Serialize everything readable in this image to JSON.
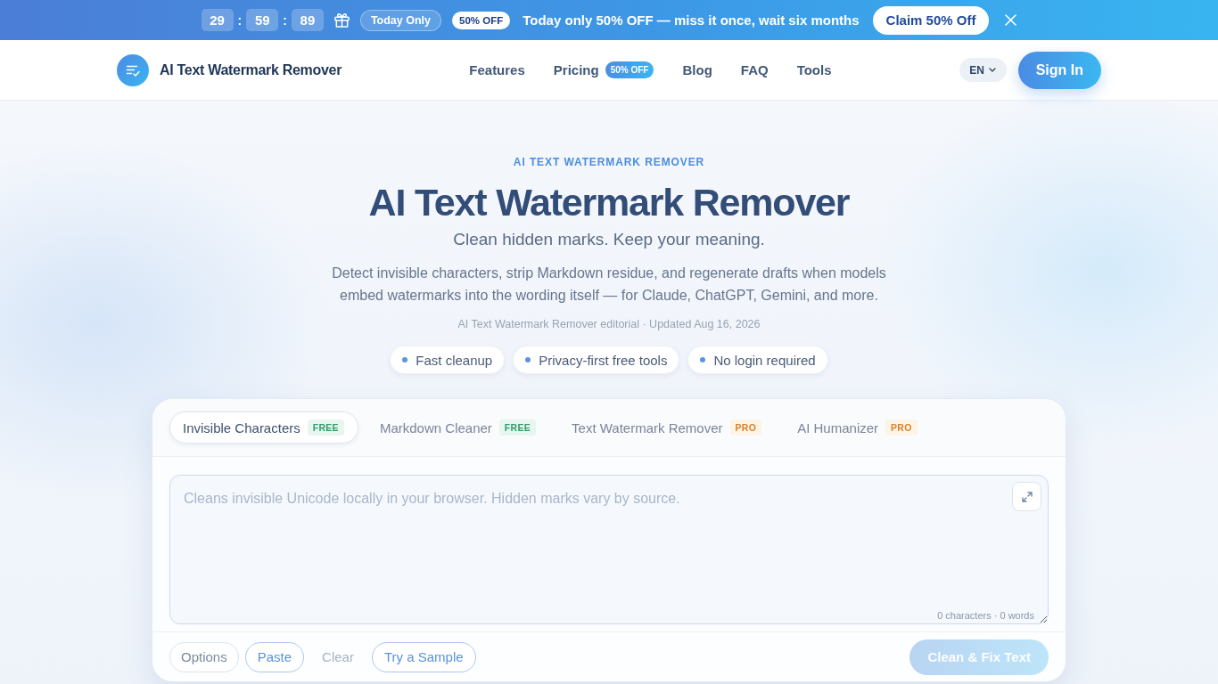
{
  "promo_bar": {
    "countdown": [
      "29",
      "59",
      "89"
    ],
    "separators": [
      ":",
      ":"
    ],
    "tag": "Today Only",
    "badge": "50% OFF",
    "message": "Today only 50% OFF — miss it once, wait six months",
    "cta": "Claim 50% Off"
  },
  "nav": {
    "brand": "AI Text Watermark Remover",
    "links": [
      {
        "label": "Features"
      },
      {
        "label": "Pricing",
        "badge": "50% OFF"
      },
      {
        "label": "Blog"
      },
      {
        "label": "FAQ"
      },
      {
        "label": "Tools"
      }
    ],
    "language": "EN",
    "sign_in": "Sign In"
  },
  "hero": {
    "eyebrow": "AI TEXT WATERMARK REMOVER",
    "title": "AI Text Watermark Remover",
    "subtitle": "Clean hidden marks. Keep your meaning.",
    "description": "Detect invisible characters, strip Markdown residue, and regenerate drafts when models embed watermarks into the wording itself — for Claude, ChatGPT, Gemini, and more.",
    "byline": "AI Text Watermark Remover editorial · Updated Aug 16, 2026",
    "highlights": [
      "Fast cleanup",
      "Privacy-first free tools",
      "No login required"
    ]
  },
  "tool": {
    "tabs": [
      {
        "label": "Invisible Characters",
        "badge": "FREE",
        "kind": "free",
        "selected": true
      },
      {
        "label": "Markdown Cleaner",
        "badge": "FREE",
        "kind": "free",
        "selected": false
      },
      {
        "label": "Text Watermark Remover",
        "badge": "PRO",
        "kind": "pro",
        "selected": false
      },
      {
        "label": "AI Humanizer",
        "badge": "PRO",
        "kind": "pro",
        "selected": false
      }
    ],
    "input": {
      "placeholder": "Cleans invisible Unicode locally in your browser. Hidden marks vary by source.",
      "counter": "0 characters · 0 words"
    },
    "actions": [
      {
        "label": "Options",
        "kind": "neutral"
      },
      {
        "label": "Paste",
        "kind": "accent"
      },
      {
        "label": "Clear",
        "kind": "plain"
      },
      {
        "label": "Try a Sample",
        "kind": "accent"
      }
    ],
    "submit": {
      "label": "Clean & Fix Text",
      "disabled": true
    }
  }
}
